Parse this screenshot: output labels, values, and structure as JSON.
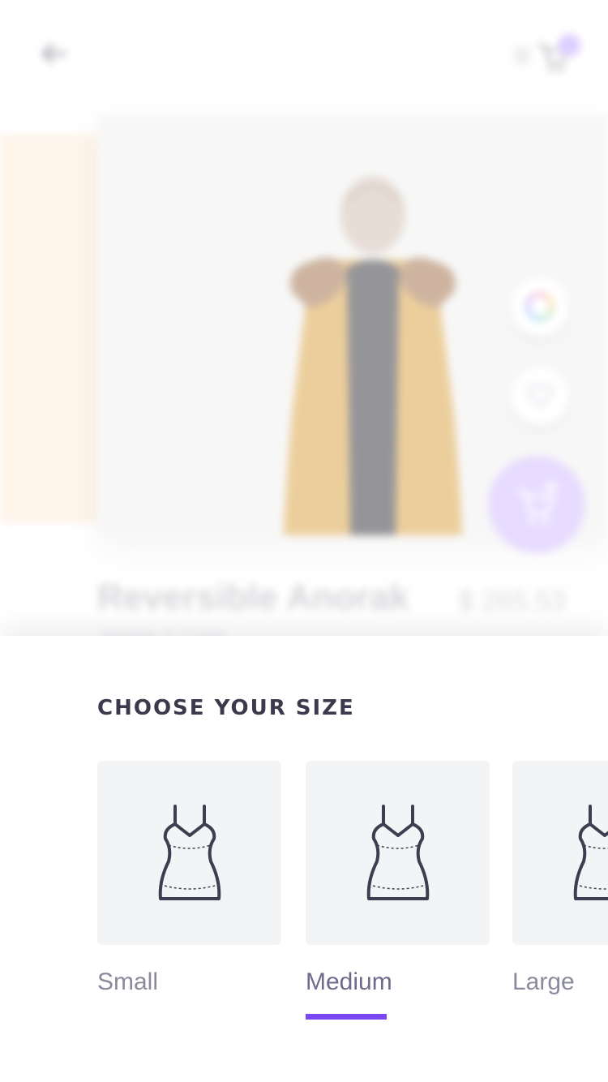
{
  "header": {
    "back_icon": "arrow-left-icon",
    "cart_icon": "shopping-cart-icon",
    "cart_count": ""
  },
  "product": {
    "name": "Reversible Anorak",
    "price": "$ 265.53",
    "category": "Jackets & Coats",
    "image_icon": "model-in-coat-image",
    "actions": {
      "color_icon": "color-wheel-icon",
      "favorite_icon": "heart-icon",
      "add_to_cart_icon": "add-to-cart-icon"
    }
  },
  "size_picker": {
    "title": "CHOOSE YOUR SIZE",
    "selected": "Medium",
    "options": [
      {
        "label": "Small",
        "icon": "dress-icon"
      },
      {
        "label": "Medium",
        "icon": "dress-icon"
      },
      {
        "label": "Large",
        "icon": "dress-icon"
      }
    ]
  },
  "colors": {
    "accent": "#7a47f5",
    "title_text": "#3b3a4c",
    "label_text": "#8a8a9e",
    "tile_bg": "#f3f4f6",
    "icon_stroke": "#3f3e50"
  }
}
